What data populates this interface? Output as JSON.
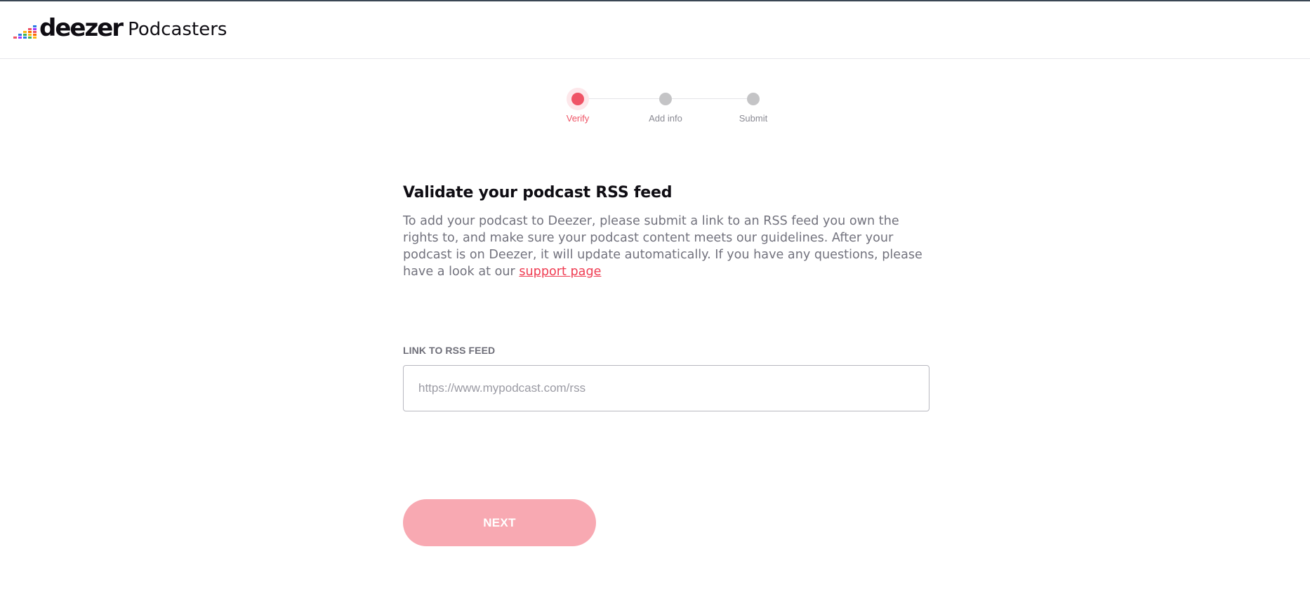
{
  "header": {
    "logo_word": "deezer",
    "logo_suffix": "Podcasters",
    "logo_bar_colors": [
      "#ef5466",
      "#a238ff",
      "#2b7be3",
      "#40b353",
      "#fdb813",
      "#ff6d00"
    ]
  },
  "stepper": {
    "steps": [
      {
        "label": "Verify",
        "active": true
      },
      {
        "label": "Add info",
        "active": false
      },
      {
        "label": "Submit",
        "active": false
      }
    ]
  },
  "main": {
    "title": "Validate your podcast RSS feed",
    "intro_text": "To add your podcast to Deezer, please submit a link to an RSS feed you own the rights to, and make sure your podcast content meets our guidelines. After your podcast is on Deezer, it will update automatically. If you have any questions, please have a look at our ",
    "support_link_text": "support page",
    "rss_field": {
      "label": "LINK TO RSS FEED",
      "value": "",
      "placeholder": "https://www.mypodcast.com/rss"
    },
    "next_button_label": "NEXT"
  },
  "colors": {
    "accent": "#ef5466",
    "button_disabled_bg": "#f8a9b2",
    "step_inactive": "#c4c4c6"
  }
}
